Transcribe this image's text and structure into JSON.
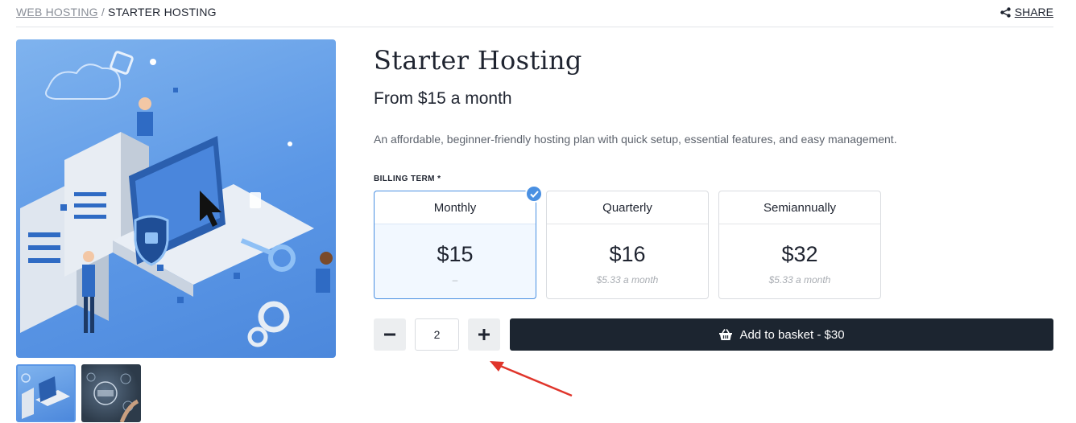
{
  "breadcrumb": {
    "parent": "WEB HOSTING",
    "separator": "/",
    "current": "STARTER HOSTING"
  },
  "share": {
    "label": "SHARE",
    "icon": "share-icon"
  },
  "product": {
    "title": "Starter Hosting",
    "price_from": "From $15 a month",
    "description": "An affordable, beginner-friendly hosting plan with quick setup, essential features, and easy management."
  },
  "billing": {
    "label": "BILLING TERM *",
    "options": [
      {
        "name": "Monthly",
        "price": "$15",
        "sub": "–",
        "selected": true
      },
      {
        "name": "Quarterly",
        "price": "$16",
        "sub": "$5.33 a month",
        "selected": false
      },
      {
        "name": "Semiannually",
        "price": "$32",
        "sub": "$5.33 a month",
        "selected": false
      }
    ]
  },
  "quantity": {
    "value": "2",
    "decrement_icon": "minus-icon",
    "increment_icon": "plus-icon"
  },
  "add_to_basket": {
    "label": "Add to basket - $30",
    "icon": "basket-icon"
  },
  "colors": {
    "accent": "#4a90e2",
    "dark_button": "#1c2530",
    "annotation_arrow": "#e0352b",
    "hero_blue": "#5b97e6"
  }
}
